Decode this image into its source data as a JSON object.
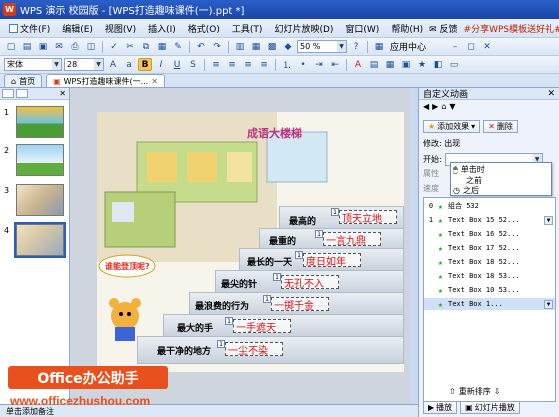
{
  "window": {
    "title": "WPS 演示 校园版 - [WPS打造趣味课件(一).ppt *]",
    "logo": "W"
  },
  "menu": {
    "items": [
      "文件(F)",
      "编辑(E)",
      "视图(V)",
      "插入(I)",
      "格式(O)",
      "工具(T)",
      "幻灯片放映(D)",
      "窗口(W)",
      "帮助(H)"
    ],
    "feedback": "反馈",
    "promo": "#分享WPS模板送好礼# 获..."
  },
  "toolbar1": {
    "zoom": "50 %",
    "app_center": "应用中心"
  },
  "toolbar2": {
    "font": "宋体",
    "size": "28",
    "bold": "B",
    "italic": "I",
    "underline": "U",
    "shadow": "S"
  },
  "tabs": [
    {
      "label": "首页"
    },
    {
      "label": "WPS打造趣味课件(一..."
    }
  ],
  "slides_panel": {
    "numbers": [
      "1",
      "2",
      "3",
      "4"
    ]
  },
  "slide": {
    "title": "成语大楼梯",
    "bubble": "谁能登顶呢?",
    "steps": [
      {
        "label": "最高的",
        "answer": "顶天立地",
        "tag": "1"
      },
      {
        "label": "最重的",
        "answer": "一言九鼎",
        "tag": "1"
      },
      {
        "label": "最长的一天",
        "answer": "度日如年",
        "tag": "1"
      },
      {
        "label": "最尖的针",
        "answer": "无孔不入",
        "tag": "1"
      },
      {
        "label": "最浪费的行为",
        "answer": "一掷千金",
        "tag": "1"
      },
      {
        "label": "最大的手",
        "answer": "一手遮天",
        "tag": "1"
      },
      {
        "label": "最干净的地方",
        "answer": "一尘不染",
        "tag": "1"
      }
    ]
  },
  "task_pane": {
    "title": "自定义动画",
    "add_effect": "添加效果",
    "remove": "删除",
    "modify": "修改: 出现",
    "start_label": "开始:",
    "property_label": "属性",
    "speed_label": "速度",
    "start_options": [
      "单击时",
      "之前",
      "之后"
    ],
    "items": [
      {
        "idx": "0",
        "label": "组合 532"
      },
      {
        "idx": "1",
        "label": "Text Box 15 52..."
      },
      {
        "idx": "",
        "label": "Text Box 16 52..."
      },
      {
        "idx": "",
        "label": "Text Box 17 52..."
      },
      {
        "idx": "",
        "label": "Text Box 18 52..."
      },
      {
        "idx": "",
        "label": "Text Box 18 53..."
      },
      {
        "idx": "",
        "label": "Text Box 10 53..."
      },
      {
        "idx": "",
        "label": "Text Box 1..."
      }
    ],
    "reorder": "重新排序",
    "play": "播放",
    "slideshow": "幻灯片播放"
  },
  "statusbar": {
    "text": "单击添加备注"
  },
  "watermark": {
    "brand": "Office办公助手",
    "website": "www.officezhushou.com"
  }
}
